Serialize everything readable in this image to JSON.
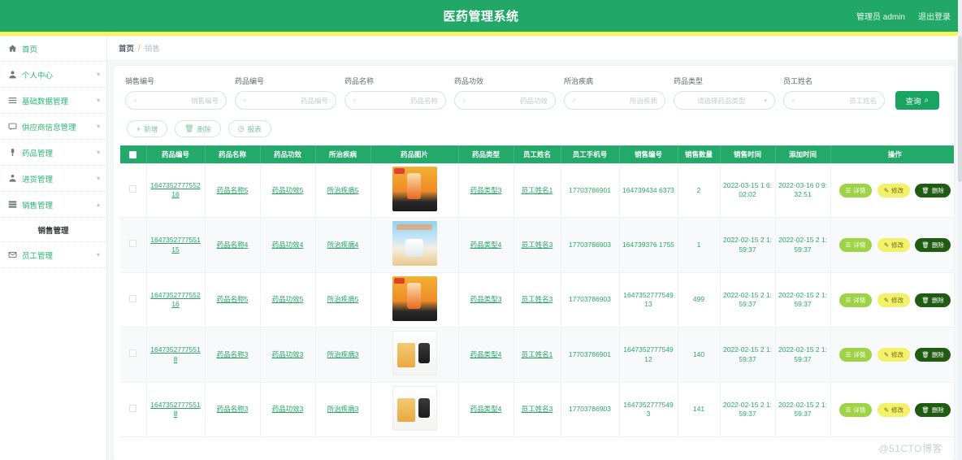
{
  "header": {
    "title": "医药管理系统",
    "user": "管理员 admin",
    "logout": "退出登录"
  },
  "sidebar": {
    "items": [
      {
        "label": "首页",
        "icon": "home-icon",
        "expandable": false
      },
      {
        "label": "个人中心",
        "icon": "user-icon",
        "expandable": true
      },
      {
        "label": "基础数据管理",
        "icon": "list-icon",
        "expandable": true
      },
      {
        "label": "供应商信息管理",
        "icon": "message-icon",
        "expandable": true
      },
      {
        "label": "药品管理",
        "icon": "pill-icon",
        "expandable": true
      },
      {
        "label": "进货管理",
        "icon": "cart-icon",
        "expandable": true
      },
      {
        "label": "销售管理",
        "icon": "grid-icon",
        "expandable": true,
        "expanded": true
      },
      {
        "label": "员工管理",
        "icon": "mail-icon",
        "expandable": true
      }
    ],
    "submenu": {
      "parent": "销售管理",
      "label": "销售管理"
    }
  },
  "breadcrumb": {
    "home": "首页",
    "separator": "/",
    "current": "销售"
  },
  "filters": {
    "fields": [
      {
        "label": "销售编号",
        "placeholder": "销售编号",
        "type": "search"
      },
      {
        "label": "药品编号",
        "placeholder": "药品编号",
        "type": "search"
      },
      {
        "label": "药品名称",
        "placeholder": "药品名称",
        "type": "search"
      },
      {
        "label": "药品功效",
        "placeholder": "药品功效",
        "type": "search"
      },
      {
        "label": "所治疾病",
        "placeholder": "所治疾病",
        "type": "search"
      },
      {
        "label": "药品类型",
        "placeholder": "请选择药品类型",
        "type": "select"
      },
      {
        "label": "员工姓名",
        "placeholder": "员工姓名",
        "type": "search"
      }
    ],
    "query_button": "查询"
  },
  "toolbar": {
    "add": "新增",
    "delete": "删除",
    "report": "报表"
  },
  "table": {
    "columns": [
      "",
      "药品编号",
      "药品名称",
      "药品功效",
      "所治疾病",
      "药品图片",
      "药品类型",
      "员工姓名",
      "员工手机号",
      "销售编号",
      "销售数量",
      "销售时间",
      "添加时间",
      "操作"
    ],
    "rows": [
      {
        "drug_code": "164735277755216",
        "drug_name": "药品名称5",
        "drug_effect": "药品功效5",
        "disease": "所治疾病5",
        "image": "orange-bottle",
        "drug_type": "药品类型3",
        "employee": "员工姓名1",
        "phone": "17703786901",
        "sale_code": "164739434 6373",
        "quantity": "2",
        "sale_time": "2022-03-15 1 6:02:02",
        "add_time": "2022-03-16 0 9:32:51"
      },
      {
        "drug_code": "164735277755115",
        "drug_name": "药品名称4",
        "drug_effect": "药品功效4",
        "disease": "所治疾病4",
        "image": "blue-box",
        "drug_type": "药品类型4",
        "employee": "员工姓名3",
        "phone": "17703786903",
        "sale_code": "164739376 1755",
        "quantity": "1",
        "sale_time": "2022-02-15 2 1:59:37",
        "add_time": "2022-02-15 2 1:59:37"
      },
      {
        "drug_code": "164735277755216",
        "drug_name": "药品名称5",
        "drug_effect": "药品功效5",
        "disease": "所治疾病5",
        "image": "orange-bottle",
        "drug_type": "药品类型3",
        "employee": "员工姓名3",
        "phone": "17703786903",
        "sale_code": "164735277754913",
        "quantity": "499",
        "sale_time": "2022-02-15 2 1:59:37",
        "add_time": "2022-02-15 2 1:59:37"
      },
      {
        "drug_code": "16473527775518",
        "drug_name": "药品名称3",
        "drug_effect": "药品功效3",
        "disease": "所治疾病3",
        "image": "white-box",
        "drug_type": "药品类型4",
        "employee": "员工姓名1",
        "phone": "17703786901",
        "sale_code": "164735277754912",
        "quantity": "140",
        "sale_time": "2022-02-15 2 1:59:37",
        "add_time": "2022-02-15 2 1:59:37"
      },
      {
        "drug_code": "16473527775518",
        "drug_name": "药品名称3",
        "drug_effect": "药品功效3",
        "disease": "所治疾病3",
        "image": "white-box",
        "drug_type": "药品类型4",
        "employee": "员工姓名3",
        "phone": "17703786903",
        "sale_code": "16473527775493",
        "quantity": "141",
        "sale_time": "2022-02-15 2 1:59:37",
        "add_time": "2022-02-15 2 1:59:37"
      }
    ],
    "operations": {
      "detail": "详情",
      "edit": "修改",
      "delete": "删除"
    }
  },
  "watermark": "@51CTO博客",
  "colors": {
    "brand_green": "#21a866",
    "accent_yellow": "#f5f45c",
    "table_header": "#23a96a",
    "link_green": "#25a566",
    "btn_detail": "#9ed345",
    "btn_edit": "#f3f06a",
    "btn_delete": "#1f5c12"
  }
}
